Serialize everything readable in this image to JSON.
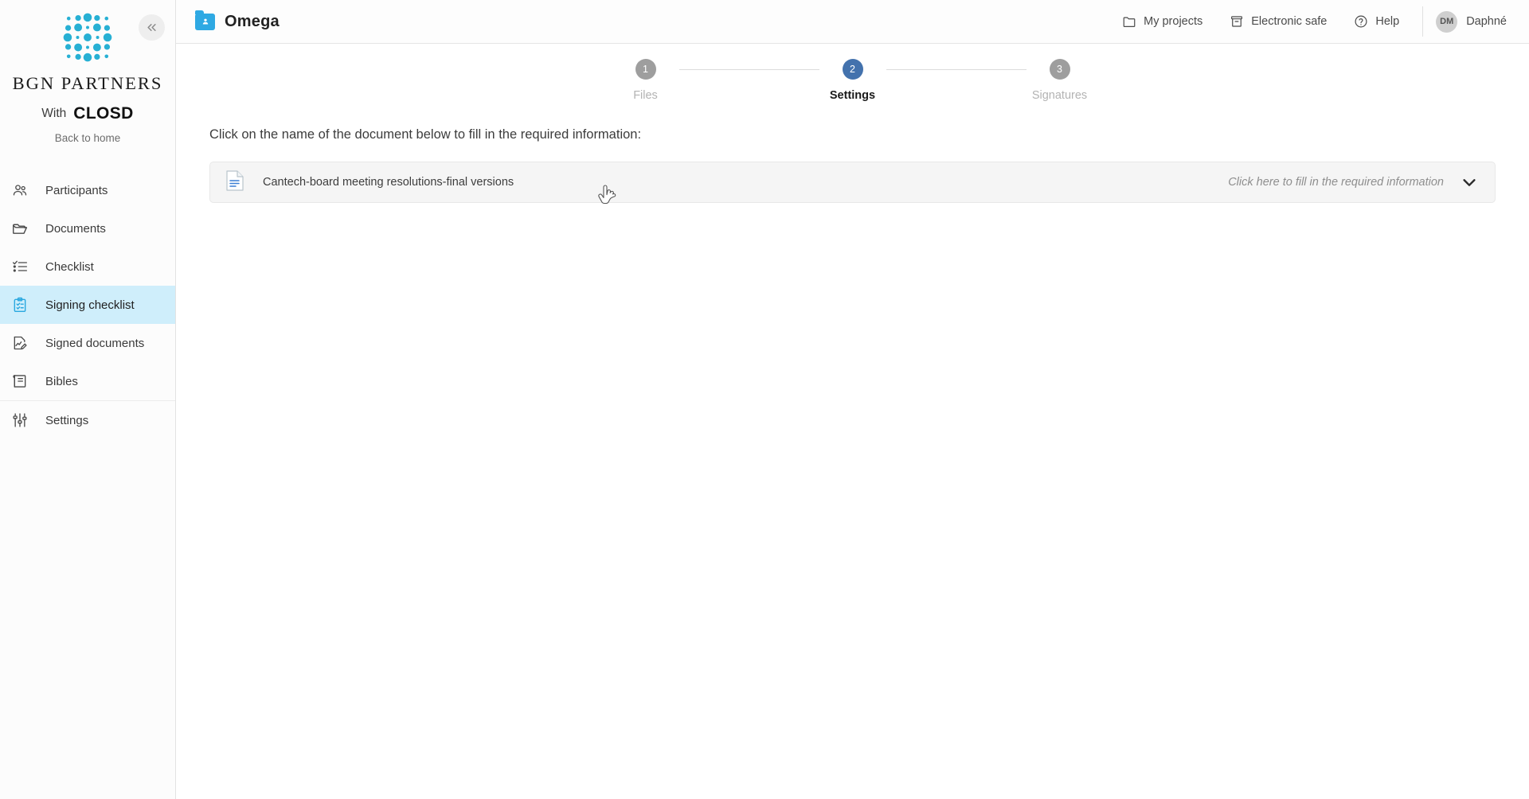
{
  "sidebar": {
    "collapse_icon": "double-chevron-left-icon",
    "logo_icon": "bgn-dot-grid-logo",
    "brand_name": "BGN PARTNERS",
    "with_label": "With",
    "partner_logo_text": "CLOSD",
    "back_to_home": "Back to home",
    "items": [
      {
        "label": "Participants",
        "icon": "people-icon",
        "active": false
      },
      {
        "label": "Documents",
        "icon": "folder-open-icon",
        "active": false
      },
      {
        "label": "Checklist",
        "icon": "checklist-icon",
        "active": false
      },
      {
        "label": "Signing checklist",
        "icon": "clipboard-check-icon",
        "active": true
      },
      {
        "label": "Signed documents",
        "icon": "document-signed-icon",
        "active": false
      },
      {
        "label": "Bibles",
        "icon": "book-icon",
        "active": false
      },
      {
        "label": "Settings",
        "icon": "sliders-icon",
        "active": false
      }
    ]
  },
  "topbar": {
    "project_icon": "folder-user-icon",
    "project_name": "Omega",
    "links": [
      {
        "label": "My projects",
        "icon": "folder-icon"
      },
      {
        "label": "Electronic safe",
        "icon": "archive-box-icon"
      },
      {
        "label": "Help",
        "icon": "question-circle-icon"
      }
    ],
    "user": {
      "initials": "DM",
      "name": "Daphné",
      "icon": "avatar"
    }
  },
  "stepper": {
    "steps": [
      {
        "number": "1",
        "label": "Files",
        "state": "inactive"
      },
      {
        "number": "2",
        "label": "Settings",
        "state": "current"
      },
      {
        "number": "3",
        "label": "Signatures",
        "state": "inactive"
      }
    ]
  },
  "main": {
    "instruction": "Click on the name of the document below to fill in the required information:",
    "document": {
      "icon": "document-lines-icon",
      "name": "Cantech-board meeting resolutions-final versions",
      "hint": "Click here to fill in the required information",
      "expand_icon": "chevron-down-icon"
    }
  },
  "colors": {
    "accent_blue": "#2fa9e3",
    "active_nav_bg": "#cfeefb",
    "step_current": "#4372ad",
    "step_inactive": "#9e9e9e"
  }
}
